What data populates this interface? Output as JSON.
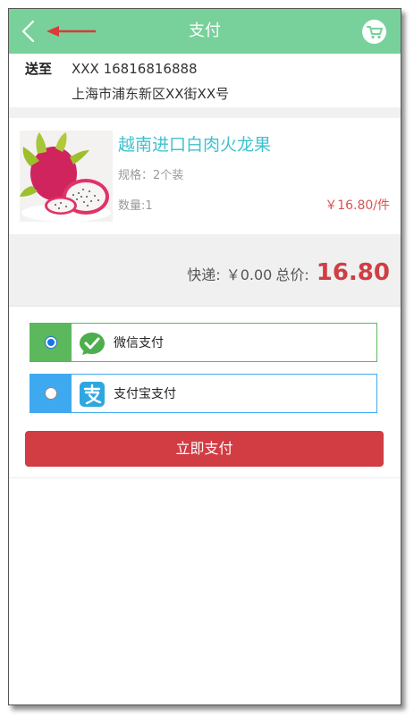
{
  "header": {
    "title": "支付",
    "back_icon": "chevron-left-icon",
    "cart_icon": "cart-icon",
    "accent_color": "#78d19a"
  },
  "address": {
    "label": "送至",
    "name_phone": "XXX 16816816888",
    "address": "上海市浦东新区XX街XX号"
  },
  "product": {
    "name": "越南进口白肉火龙果",
    "spec": "规格：2个装",
    "quantity": "数量:1",
    "price": "￥16.80/件"
  },
  "summary": {
    "shipping_label": "快递:",
    "shipping_value": "￥0.00",
    "total_label": "总价:",
    "total_value": "16.80"
  },
  "payment": {
    "options": [
      {
        "label": "微信支付",
        "selected": true,
        "color": "#5cb85c",
        "icon": "wechat-pay-icon"
      },
      {
        "label": "支付宝支付",
        "selected": false,
        "color": "#3fa9f0",
        "icon": "alipay-icon"
      }
    ],
    "submit_label": "立即支付",
    "submit_color": "#d23c43"
  }
}
